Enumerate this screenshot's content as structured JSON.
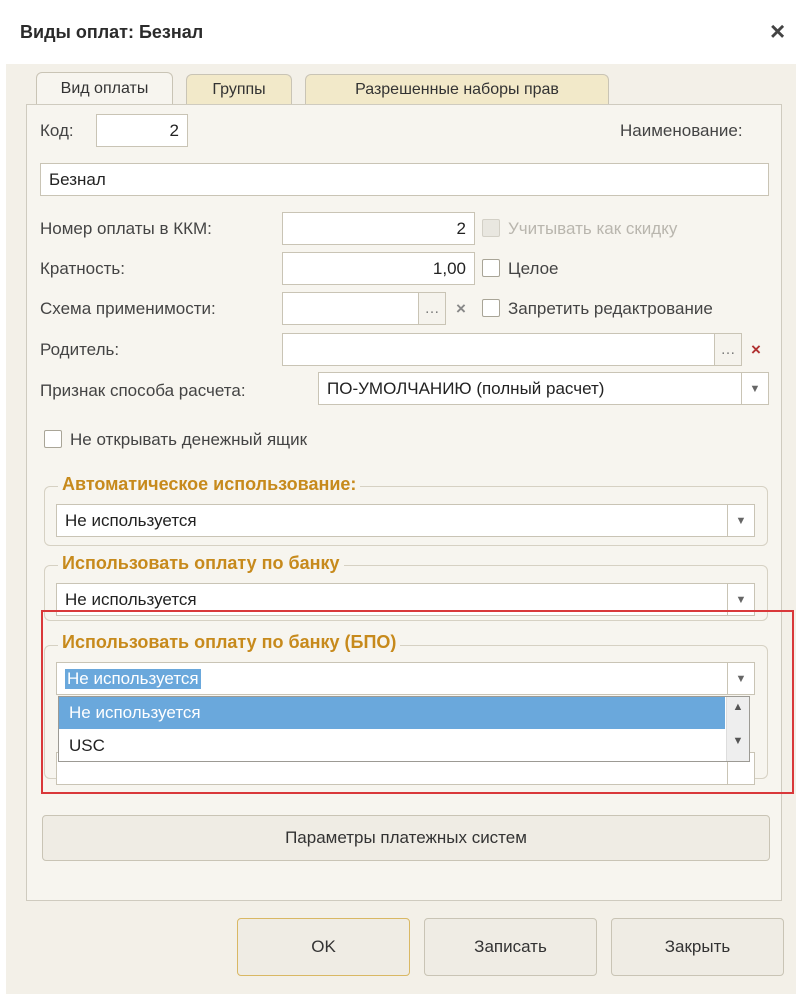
{
  "window": {
    "title": "Виды оплат: Безнал",
    "close_icon": "×"
  },
  "tabs": [
    "Вид оплаты",
    "Группы",
    "Разрешенные наборы прав"
  ],
  "form": {
    "code_label": "Код:",
    "code_value": "2",
    "name_label": "Наименование:",
    "name_value": "Безнал",
    "kkm_label": "Номер оплаты в ККМ:",
    "kkm_value": "2",
    "discount_label": "Учитывать как скидку",
    "multiplicity_label": "Кратность:",
    "multiplicity_value": "1,00",
    "whole_label": "Целое",
    "scheme_label": "Схема применимости:",
    "scheme_value": "",
    "forbid_edit_label": "Запретить редактрование",
    "parent_label": "Родитель:",
    "parent_value": "",
    "calc_label": "Признак способа расчета:",
    "calc_value": "ПО-УМОЛЧАНИЮ (полный расчет)",
    "no_drawer_label": "Не открывать денежный ящик"
  },
  "groups": {
    "auto_title": "Автоматическое использование:",
    "auto_value": "Не используется",
    "bank_title": "Использовать оплату по банку",
    "bank_value": "Не используется",
    "bpo_title": "Использовать оплату по банку (БПО)",
    "bpo_value": "Не используется"
  },
  "dropdown": {
    "options": [
      "Не используется",
      "USC"
    ],
    "selected": "Не используется"
  },
  "buttons": {
    "payment_systems": "Параметры платежных систем",
    "ok": "OK",
    "save": "Записать",
    "close": "Закрыть"
  },
  "colors": {
    "group_title": "#c78a1c",
    "highlight": "#6aa8dc",
    "red_outline": "#d9383a"
  }
}
